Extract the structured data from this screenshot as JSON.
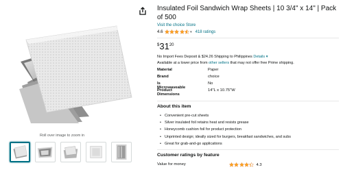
{
  "product": {
    "title": "Insulated Foil Sandwich Wrap Sheets | 10 3/4\" x 14\" | Pack of 500",
    "store_link": "Visit the choice Store",
    "rating_value": "4.6",
    "rating_stars": 4.6,
    "ratings_count": "418 ratings"
  },
  "price": {
    "symbol": "$",
    "whole": "31",
    "fraction": "20"
  },
  "shipping": {
    "text": "No Import Fees Deposit & $24.26 Shipping to Philippines ",
    "details_link": "Details",
    "caret": "▾"
  },
  "availability": {
    "prefix": "Available at a lower price from ",
    "link": "other sellers",
    "suffix": " that may not offer free Prime shipping."
  },
  "specs": [
    {
      "key": "Material",
      "value": "Paper"
    },
    {
      "key": "Brand",
      "value": "choice"
    },
    {
      "key": "Is Microwaveable",
      "value": "No"
    },
    {
      "key": "Product Dimensions",
      "value": "14\"L x 10.75\"W"
    }
  ],
  "about": {
    "heading": "About this item",
    "bullets": [
      "Convenient pre-cut sheets",
      "Silver insulated foil retains heat and resists grease",
      "Honeycomb cushion foil for product protection",
      "Unprinted design; ideally sized for burgers, breakfast sandwiches, and subs",
      "Great for grab-and-go applications"
    ]
  },
  "customer_ratings": {
    "heading": "Customer ratings by feature",
    "features": [
      {
        "label": "Value for money",
        "value": "4.3",
        "stars": 4.3
      }
    ]
  },
  "gallery": {
    "zoom_hint": "Roll over image to zoom in",
    "thumbnail_count": 5,
    "active_index": 0
  },
  "colors": {
    "link": "#007185",
    "star": "#FFA41C",
    "text": "#0F1111"
  },
  "icons": {
    "share": "share-icon",
    "star": "star-icon"
  }
}
